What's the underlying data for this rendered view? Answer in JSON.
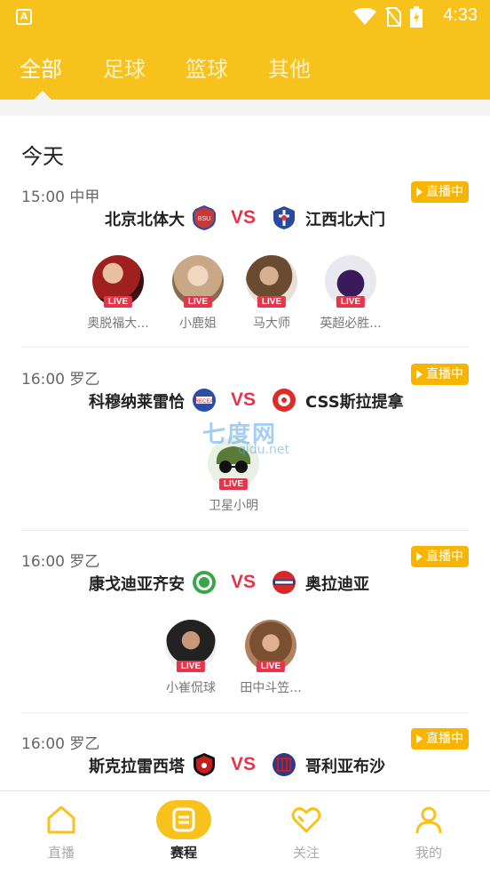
{
  "status_bar": {
    "app_icon_letter": "A",
    "time": "4:33",
    "icons": [
      "wifi-icon",
      "no-sim-icon",
      "battery-charging-icon"
    ]
  },
  "tabs": [
    {
      "label": "全部",
      "active": true
    },
    {
      "label": "足球",
      "active": false
    },
    {
      "label": "篮球",
      "active": false
    },
    {
      "label": "其他",
      "active": false
    }
  ],
  "section_title": "今天",
  "live_badge_label": "直播中",
  "live_tag": "LIVE",
  "vs_label": "VS",
  "matches": [
    {
      "time_league": "15:00 中甲",
      "home": "北京北体大",
      "away": "江西北大门",
      "home_logo_color": "#c23b3b",
      "away_logo_color": "#2a4aa0",
      "streamers": [
        "奥脱福大...",
        "小鹿姐",
        "马大师",
        "英超必胜..."
      ]
    },
    {
      "time_league": "16:00 罗乙",
      "home": "科穆纳莱雷恰",
      "away": "CSS斯拉提拿",
      "home_logo_color": "#2b4fa8",
      "away_logo_color": "#e02b2b",
      "streamers": [
        "卫星小明"
      ]
    },
    {
      "time_league": "16:00 罗乙",
      "home": "康戈迪亚齐安",
      "away": "奥拉迪亚",
      "home_logo_color": "#3aa64a",
      "away_logo_color": "#d62a2a",
      "streamers": [
        "小崔侃球",
        "田中斗笠..."
      ]
    },
    {
      "time_league": "16:00 罗乙",
      "home": "斯克拉雷西塔",
      "away": "哥利亚布沙",
      "home_logo_color": "#c41e1e",
      "away_logo_color": "#2d3a8c",
      "streamers": []
    }
  ],
  "watermark": {
    "main": "七度网",
    "sub": "qidu.net"
  },
  "bottom_nav": [
    {
      "label": "直播",
      "icon": "home-icon",
      "active": false
    },
    {
      "label": "赛程",
      "icon": "schedule-icon",
      "active": true
    },
    {
      "label": "关注",
      "icon": "heart-icon",
      "active": false
    },
    {
      "label": "我的",
      "icon": "profile-icon",
      "active": false
    }
  ],
  "colors": {
    "brand_yellow": "#f7c21c",
    "badge_orange": "#f7b500",
    "vs_red": "#e8344a",
    "live_red": "#e8344a"
  }
}
